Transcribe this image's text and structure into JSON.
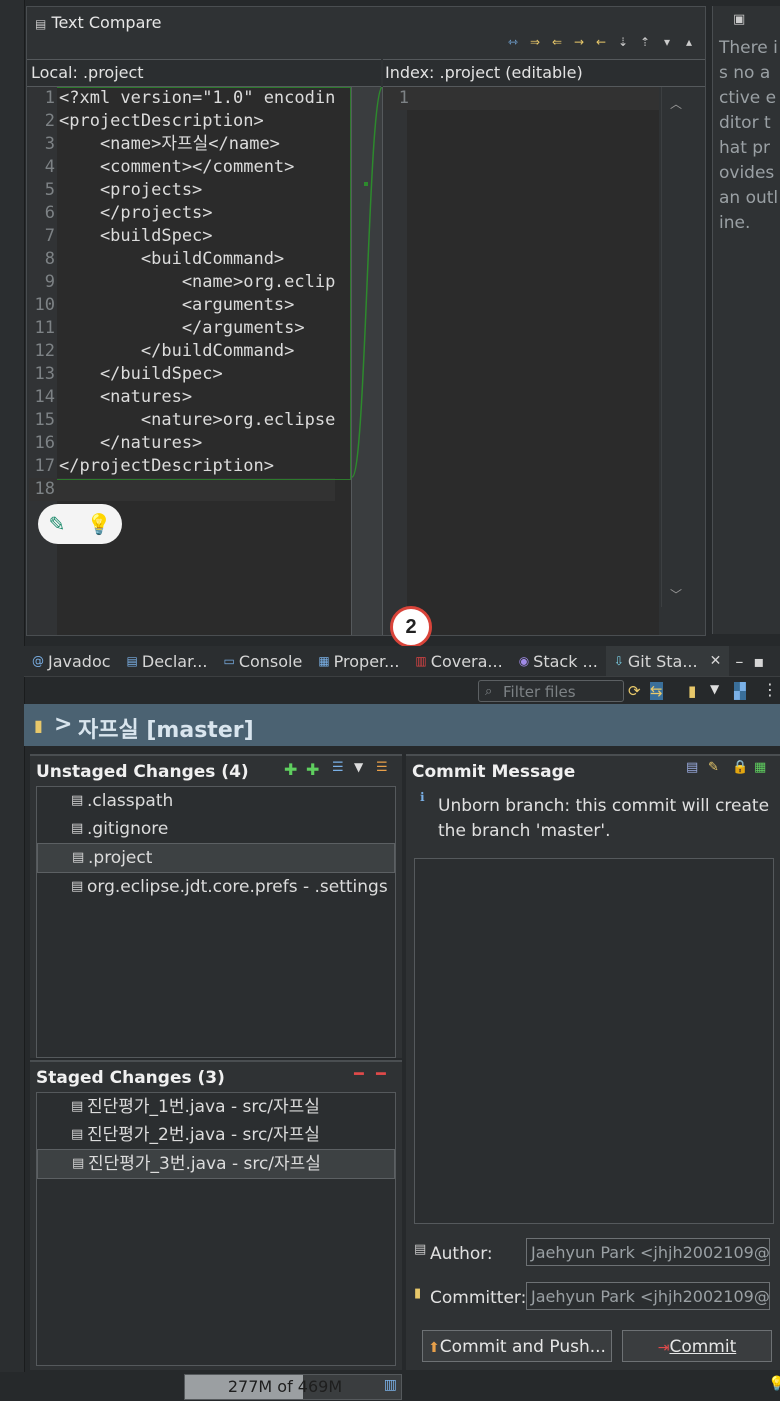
{
  "compare": {
    "title": "Text Compare",
    "left_header": "Local: .project",
    "right_header": "Index: .project (editable)",
    "left_lines": [
      {
        "n": "1",
        "t": "<?xml version=\"1.0\" encodin"
      },
      {
        "n": "2",
        "t": "<projectDescription>"
      },
      {
        "n": "3",
        "t": "    <name>자프실</name>"
      },
      {
        "n": "4",
        "t": "    <comment></comment>"
      },
      {
        "n": "5",
        "t": "    <projects>"
      },
      {
        "n": "6",
        "t": "    </projects>"
      },
      {
        "n": "7",
        "t": "    <buildSpec>"
      },
      {
        "n": "8",
        "t": "        <buildCommand>"
      },
      {
        "n": "9",
        "t": "            <name>org.eclip"
      },
      {
        "n": "10",
        "t": "            <arguments>"
      },
      {
        "n": "11",
        "t": "            </arguments>"
      },
      {
        "n": "12",
        "t": "        </buildCommand>"
      },
      {
        "n": "13",
        "t": "    </buildSpec>"
      },
      {
        "n": "14",
        "t": "    <natures>"
      },
      {
        "n": "15",
        "t": "        <nature>org.eclipse"
      },
      {
        "n": "16",
        "t": "    </natures>"
      },
      {
        "n": "17",
        "t": "</projectDescription>"
      },
      {
        "n": "18",
        "t": ""
      }
    ],
    "right_line_number": "1"
  },
  "outline": {
    "text": "There is no active editor that provides an outline."
  },
  "tabs": [
    {
      "label": "Javadoc"
    },
    {
      "label": "Declar..."
    },
    {
      "label": "Console"
    },
    {
      "label": "Proper..."
    },
    {
      "label": "Covera..."
    },
    {
      "label": "Stack ..."
    },
    {
      "label": "Git Sta..."
    }
  ],
  "annotation_badge": "2",
  "filter_placeholder": "Filter files",
  "repo": {
    "label": "자프실 [master]"
  },
  "unstaged": {
    "title": "Unstaged Changes (4)",
    "items": [
      ".classpath",
      ".gitignore",
      ".project",
      "org.eclipse.jdt.core.prefs - .settings"
    ]
  },
  "staged": {
    "title": "Staged Changes (3)",
    "items": [
      "진단평가_1번.java - src/자프실",
      "진단평가_2번.java - src/자프실",
      "진단평가_3번.java - src/자프실"
    ]
  },
  "commit": {
    "title": "Commit Message",
    "info_line1": "Unborn branch: this commit will create",
    "info_line2": "the branch 'master'.",
    "author_label": "Author:",
    "author_value": "Jaehyun Park <jhjh2002109@",
    "committer_label": "Committer:",
    "committer_value": "Jaehyun Park <jhjh2002109@",
    "commit_push_label": "Commit and Push...",
    "commit_label": "Commit"
  },
  "status": {
    "heap": "277M of 469M",
    "heap_fraction": 0.59
  }
}
